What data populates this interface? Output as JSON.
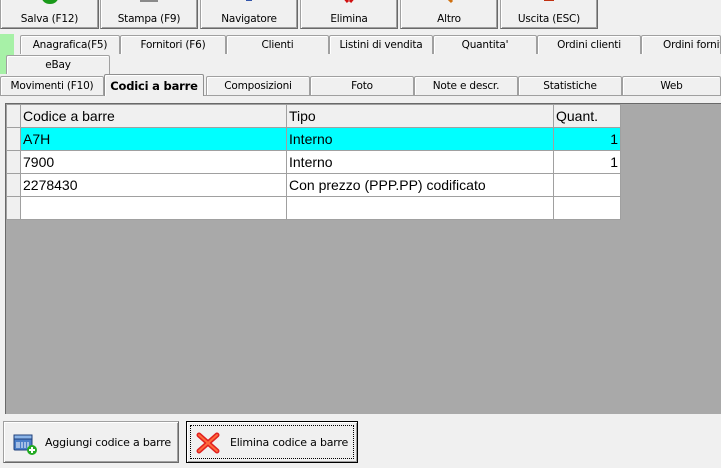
{
  "toolbar": {
    "buttons": [
      {
        "label": "Salva (F12)",
        "icon": "save-icon",
        "color": "#1a9a1a"
      },
      {
        "label": "Stampa (F9)",
        "icon": "print-icon",
        "color": "#808080"
      },
      {
        "label": "Navigatore",
        "icon": "navigator-icon",
        "color": "#3355aa"
      },
      {
        "label": "Elimina",
        "icon": "delete-icon",
        "color": "#d01010"
      },
      {
        "label": "Altro",
        "icon": "other-icon",
        "color": "#d07010"
      },
      {
        "label": "Uscita (ESC)",
        "icon": "exit-icon",
        "color": "#c03010"
      }
    ]
  },
  "tabs": {
    "row1": [
      "Anagrafica(F5)",
      "Fornitori (F6)",
      "Clienti",
      "Listini di vendita",
      "Quantita'",
      "Ordini clienti",
      "Ordini fornito"
    ],
    "row1b": [
      "eBay"
    ],
    "row2": [
      "Movimenti (F10)",
      "Codici a barre",
      "Composizioni",
      "Foto",
      "Note e descr.",
      "Statistiche",
      "Web"
    ],
    "active": "Codici a barre"
  },
  "grid": {
    "columns": [
      "Codice a barre",
      "Tipo",
      "Quant."
    ],
    "rows": [
      {
        "code": "A7H",
        "type": "Interno",
        "qty": "1",
        "selected": true
      },
      {
        "code": "7900",
        "type": "Interno",
        "qty": "1",
        "selected": false
      },
      {
        "code": "2278430",
        "type": "Con prezzo (PPP.PP) codificato",
        "qty": "",
        "selected": false
      },
      {
        "code": "",
        "type": "",
        "qty": "",
        "selected": false
      }
    ],
    "selection_color": "#00ffff",
    "background_color": "#a9a9a9"
  },
  "actions": {
    "add_label": "Aggiungi codice a barre",
    "add_icon": "add-barcode-icon",
    "delete_label": "Elimina codice a barre",
    "delete_icon": "delete-barcode-icon"
  }
}
